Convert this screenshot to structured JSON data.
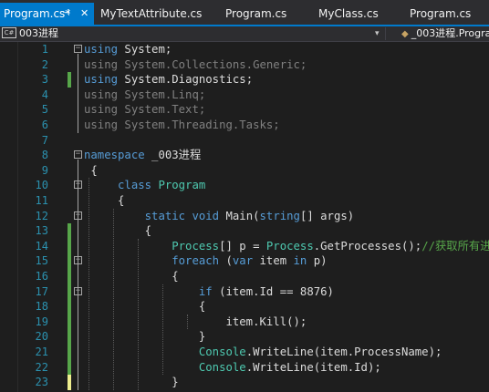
{
  "tabs": [
    {
      "label": "Program.cs*",
      "active": true,
      "pin_glyph": "⊣",
      "close_glyph": "✕"
    },
    {
      "label": "MyTextAttribute.cs"
    },
    {
      "label": "Program.cs"
    },
    {
      "label": "MyClass.cs"
    },
    {
      "label": "Program.cs"
    }
  ],
  "navbar": {
    "project_icon": "C#",
    "project": "003进程",
    "dropdown_glyph": "▾",
    "class_icon": "class-cube-icon",
    "class_path": "_003进程.Progra"
  },
  "colors": {
    "accent": "#007acc",
    "keyword": "#569cd6",
    "type": "#4ec9b0",
    "comment": "#57a64a",
    "line_number": "#2b91af",
    "changed_saved": "#57a64a",
    "changed_unsaved": "#efef8f"
  },
  "code_lines": [
    {
      "n": "1",
      "chg": "",
      "fold": "−",
      "segs": [
        {
          "c": "kw",
          "t": "using"
        },
        {
          "c": "pl",
          "t": " System;"
        }
      ]
    },
    {
      "n": "2",
      "chg": "",
      "fold": "",
      "segs": [
        {
          "c": "dim",
          "t": "using System.Collections.Generic;"
        }
      ]
    },
    {
      "n": "3",
      "chg": "saved",
      "fold": "",
      "segs": [
        {
          "c": "kw",
          "t": "using"
        },
        {
          "c": "pl",
          "t": " System.Diagnostics;"
        }
      ]
    },
    {
      "n": "4",
      "chg": "",
      "fold": "",
      "segs": [
        {
          "c": "dim",
          "t": "using System.Linq;"
        }
      ]
    },
    {
      "n": "5",
      "chg": "",
      "fold": "",
      "segs": [
        {
          "c": "dim",
          "t": "using System.Text;"
        }
      ]
    },
    {
      "n": "6",
      "chg": "",
      "fold": "",
      "segs": [
        {
          "c": "dim",
          "t": "using System.Threading.Tasks;"
        }
      ]
    },
    {
      "n": "7",
      "chg": "",
      "fold": "",
      "segs": []
    },
    {
      "n": "8",
      "chg": "",
      "fold": "−",
      "segs": [
        {
          "c": "kw",
          "t": "namespace"
        },
        {
          "c": "pl",
          "t": " _003进程"
        }
      ]
    },
    {
      "n": "9",
      "chg": "",
      "fold": "",
      "segs": [
        {
          "c": "pl",
          "t": " {"
        }
      ]
    },
    {
      "n": "10",
      "chg": "",
      "fold": "−",
      "segs": [
        {
          "c": "pl",
          "t": "     "
        },
        {
          "c": "kw",
          "t": "class"
        },
        {
          "c": "pl",
          "t": " "
        },
        {
          "c": "ty",
          "t": "Program"
        }
      ]
    },
    {
      "n": "11",
      "chg": "",
      "fold": "",
      "segs": [
        {
          "c": "pl",
          "t": "     {"
        }
      ]
    },
    {
      "n": "12",
      "chg": "",
      "fold": "−",
      "segs": [
        {
          "c": "pl",
          "t": "         "
        },
        {
          "c": "kw",
          "t": "static"
        },
        {
          "c": "pl",
          "t": " "
        },
        {
          "c": "kw",
          "t": "void"
        },
        {
          "c": "pl",
          "t": " Main("
        },
        {
          "c": "kw",
          "t": "string"
        },
        {
          "c": "pl",
          "t": "[] args)"
        }
      ]
    },
    {
      "n": "13",
      "chg": "saved",
      "fold": "",
      "segs": [
        {
          "c": "pl",
          "t": "         {"
        }
      ]
    },
    {
      "n": "14",
      "chg": "saved",
      "fold": "",
      "segs": [
        {
          "c": "pl",
          "t": "             "
        },
        {
          "c": "ty",
          "t": "Process"
        },
        {
          "c": "pl",
          "t": "[] p = "
        },
        {
          "c": "ty",
          "t": "Process"
        },
        {
          "c": "pl",
          "t": ".GetProcesses();"
        },
        {
          "c": "cm",
          "t": "//获取所有进程"
        }
      ]
    },
    {
      "n": "15",
      "chg": "saved",
      "fold": "−",
      "segs": [
        {
          "c": "pl",
          "t": "             "
        },
        {
          "c": "kw",
          "t": "foreach"
        },
        {
          "c": "pl",
          "t": " ("
        },
        {
          "c": "kw",
          "t": "var"
        },
        {
          "c": "pl",
          "t": " item "
        },
        {
          "c": "kw",
          "t": "in"
        },
        {
          "c": "pl",
          "t": " p)"
        }
      ]
    },
    {
      "n": "16",
      "chg": "saved",
      "fold": "",
      "segs": [
        {
          "c": "pl",
          "t": "             {"
        }
      ]
    },
    {
      "n": "17",
      "chg": "saved",
      "fold": "−",
      "segs": [
        {
          "c": "pl",
          "t": "                 "
        },
        {
          "c": "kw",
          "t": "if"
        },
        {
          "c": "pl",
          "t": " (item.Id == 8876)"
        }
      ]
    },
    {
      "n": "18",
      "chg": "saved",
      "fold": "",
      "segs": [
        {
          "c": "pl",
          "t": "                 {"
        }
      ]
    },
    {
      "n": "19",
      "chg": "saved",
      "fold": "",
      "segs": [
        {
          "c": "pl",
          "t": "                     item.Kill();"
        }
      ]
    },
    {
      "n": "20",
      "chg": "saved",
      "fold": "",
      "segs": [
        {
          "c": "pl",
          "t": "                 }"
        }
      ]
    },
    {
      "n": "21",
      "chg": "saved",
      "fold": "",
      "segs": [
        {
          "c": "pl",
          "t": "                 "
        },
        {
          "c": "ty",
          "t": "Console"
        },
        {
          "c": "pl",
          "t": ".WriteLine(item.ProcessName);"
        }
      ]
    },
    {
      "n": "22",
      "chg": "saved",
      "fold": "",
      "segs": [
        {
          "c": "pl",
          "t": "                 "
        },
        {
          "c": "ty",
          "t": "Console"
        },
        {
          "c": "pl",
          "t": ".WriteLine(item.Id);"
        }
      ]
    },
    {
      "n": "23",
      "chg": "unsaved",
      "fold": "",
      "segs": [
        {
          "c": "pl",
          "t": "             }"
        }
      ]
    }
  ]
}
